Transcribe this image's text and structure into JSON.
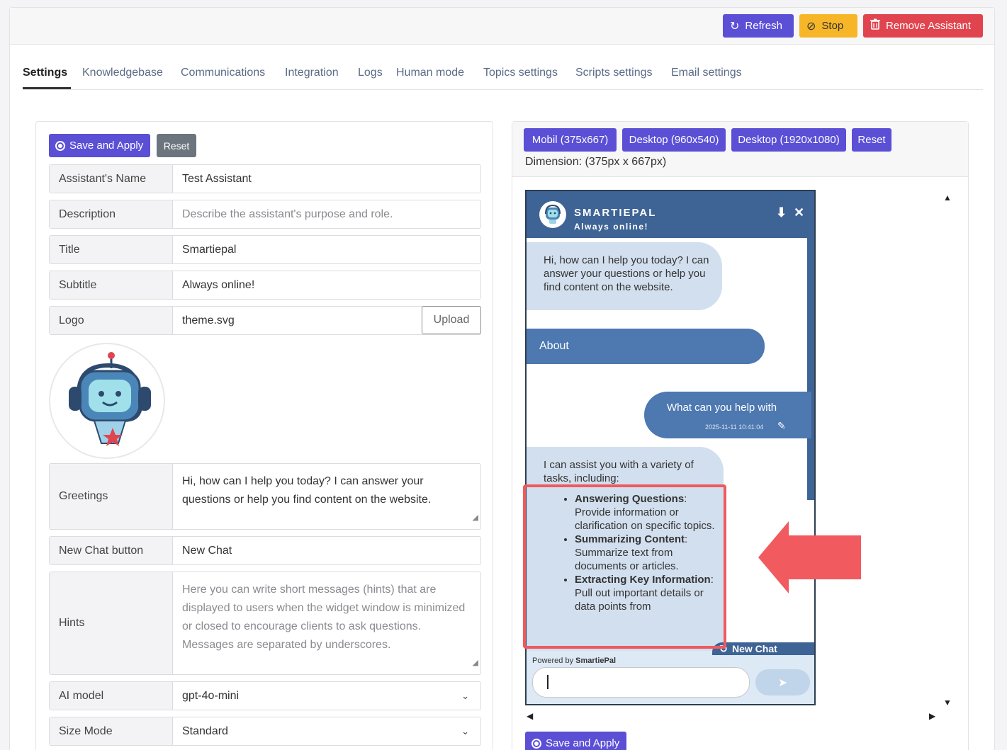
{
  "toolbar": {
    "refresh_label": "Refresh",
    "stop_label": "Stop",
    "remove_label": "Remove Assistant"
  },
  "tabs": [
    {
      "label": "Settings",
      "active": true
    },
    {
      "label": "Knowledgebase"
    },
    {
      "label": "Communications"
    },
    {
      "label": "Integration"
    },
    {
      "label": "Logs"
    },
    {
      "label": "Human mode"
    },
    {
      "label": "Topics settings"
    },
    {
      "label": "Scripts settings"
    },
    {
      "label": "Email settings"
    }
  ],
  "form": {
    "save_label": "Save and Apply",
    "reset_label": "Reset",
    "fields": {
      "name": {
        "label": "Assistant's Name",
        "value": "Test Assistant"
      },
      "description": {
        "label": "Description",
        "placeholder": "Describe the assistant's purpose and role."
      },
      "title": {
        "label": "Title",
        "value": "Smartiepal"
      },
      "subtitle": {
        "label": "Subtitle",
        "value": "Always online!"
      },
      "logo": {
        "label": "Logo",
        "value": "theme.svg",
        "upload_label": "Upload"
      },
      "greetings": {
        "label": "Greetings",
        "value": "Hi, how can I help you today? I can answer your questions or help you find content on the website."
      },
      "new_chat": {
        "label": "New Chat button",
        "value": "New Chat"
      },
      "hints": {
        "label": "Hints",
        "placeholder": "Here you can write short messages (hints) that are displayed to users when the widget window is minimized or closed to encourage clients to ask questions. Messages are separated by underscores."
      },
      "ai_model": {
        "label": "AI model",
        "value": "gpt-4o-mini"
      },
      "size_mode": {
        "label": "Size Mode",
        "value": "Standard"
      }
    }
  },
  "preview": {
    "buttons": [
      "Mobil (375x667)",
      "Desktop (960x540)",
      "Desktop (1920x1080)",
      "Reset"
    ],
    "dimension": "Dimension: (375px x 667px)",
    "save_label": "Save and Apply",
    "widget": {
      "title": "SMARTIEPAL",
      "subtitle": "Always online!",
      "greeting": "Hi, how can I help you today? I can answer your questions or help you find content on the website.",
      "about_label": "About",
      "user_message": "What can you help with",
      "user_timestamp": "2025-11-11 10:41:04",
      "reply_intro": "I can assist you with a variety of tasks, including:",
      "reply_items": [
        {
          "bold": "Answering Questions",
          "text": ": Provide information or clarification on specific topics."
        },
        {
          "bold": "Summarizing Content",
          "text": ": Summarize text from documents or articles."
        },
        {
          "bold": "Extracting Key Information",
          "text": ": Pull out important details or data points from"
        }
      ],
      "new_chat_label": "New Chat",
      "powered_prefix": "Powered by ",
      "powered_brand": "SmartiePal"
    }
  },
  "colors": {
    "primary": "#5b4fd6",
    "warning": "#f6b628",
    "danger": "#e0454f",
    "widget_header": "#3e6395",
    "widget_bubble": "#d2dfee",
    "highlight": "#ee5a5f"
  },
  "icons": {
    "refresh": "refresh-icon",
    "stop": "stop-icon",
    "remove": "trash-icon",
    "save": "radio-icon",
    "minimize": "download-arrow-icon",
    "close": "close-icon",
    "send": "send-icon"
  }
}
